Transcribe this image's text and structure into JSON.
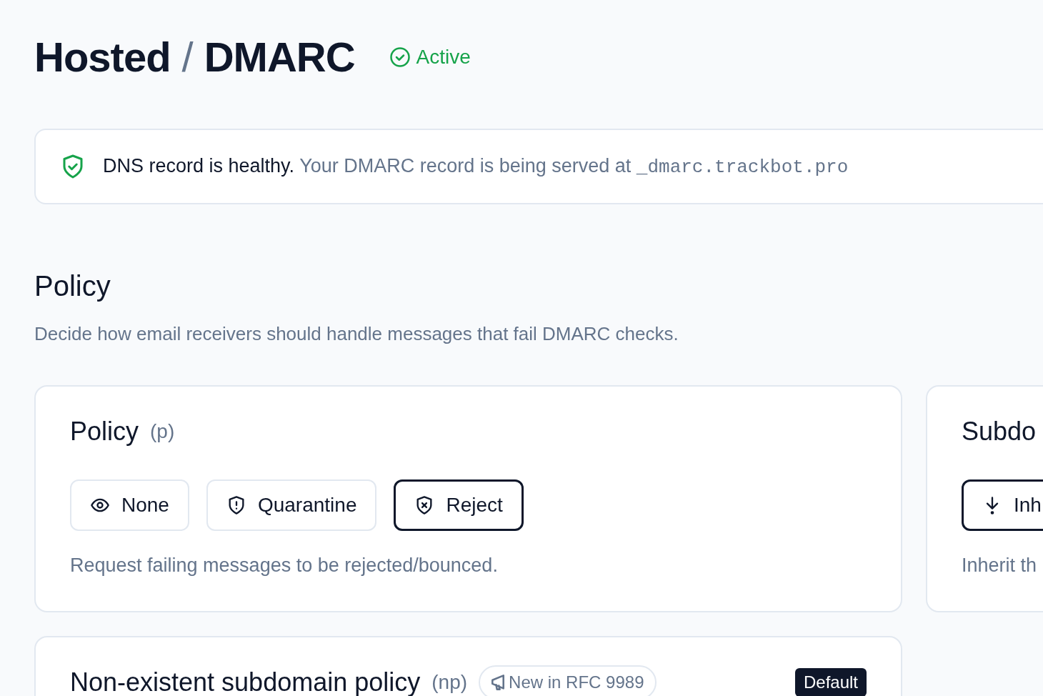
{
  "header": {
    "title": "Hosted",
    "separator": "/",
    "subtitle": "DMARC",
    "status": "Active"
  },
  "banner": {
    "title": "DNS record is healthy.",
    "message": "Your DMARC record is being served at",
    "record": "_dmarc.trackbot.pro"
  },
  "section": {
    "title": "Policy",
    "description": "Decide how email receivers should handle messages that fail DMARC checks."
  },
  "cards": [
    {
      "title": "Policy",
      "tag": "(p)",
      "options": [
        {
          "label": "None",
          "kind": "eye",
          "selected": false
        },
        {
          "label": "Quarantine",
          "kind": "shield-alert",
          "selected": false
        },
        {
          "label": "Reject",
          "kind": "shield-x",
          "selected": true
        }
      ],
      "hint": "Request failing messages to be rejected/bounced."
    },
    {
      "title": "Subdo",
      "options": [
        {
          "label": "Inh",
          "kind": "arrow-down",
          "selected": true
        }
      ],
      "hint": "Inherit th"
    },
    {
      "title": "Non-existent subdomain policy",
      "tag": "(np)",
      "pill": "New in RFC 9989",
      "badge": "Default"
    }
  ]
}
